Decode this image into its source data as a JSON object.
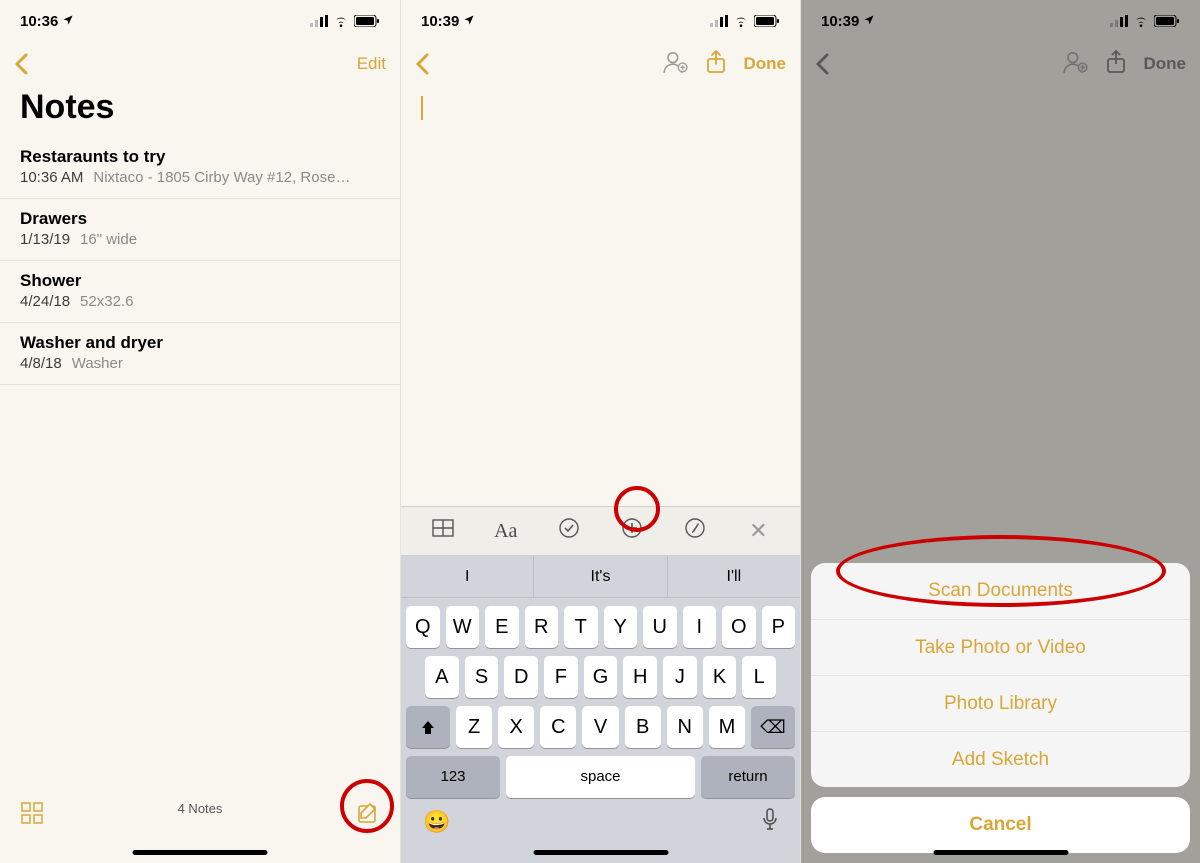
{
  "accent_color": "#d9a638",
  "screen1": {
    "status_time": "10:36",
    "nav_edit": "Edit",
    "title": "Notes",
    "notes": [
      {
        "title": "Restaraunts to try",
        "date": "10:36 AM",
        "preview": "Nixtaco - 1805 Cirby Way #12, Rosevi..."
      },
      {
        "title": "Drawers",
        "date": "1/13/19",
        "preview": "16\" wide"
      },
      {
        "title": "Shower",
        "date": "4/24/18",
        "preview": "52x32.6"
      },
      {
        "title": "Washer and dryer",
        "date": "4/8/18",
        "preview": "Washer"
      }
    ],
    "footer_count": "4 Notes"
  },
  "screen2": {
    "status_time": "10:39",
    "nav_done": "Done",
    "format_bar": [
      "table-icon",
      "Aa",
      "check-circle-icon",
      "plus-circle-icon",
      "stylus-icon",
      "close-icon"
    ],
    "predictions": [
      "I",
      "It's",
      "I'll"
    ],
    "keyboard_rows": [
      [
        "Q",
        "W",
        "E",
        "R",
        "T",
        "Y",
        "U",
        "I",
        "O",
        "P"
      ],
      [
        "A",
        "S",
        "D",
        "F",
        "G",
        "H",
        "J",
        "K",
        "L"
      ],
      [
        "shift",
        "Z",
        "X",
        "C",
        "V",
        "B",
        "N",
        "M",
        "backspace"
      ]
    ],
    "bottom_keys": {
      "num": "123",
      "space": "space",
      "return": "return"
    }
  },
  "screen3": {
    "status_time": "10:39",
    "nav_done": "Done",
    "sheet_items": [
      "Scan Documents",
      "Take Photo or Video",
      "Photo Library",
      "Add Sketch"
    ],
    "cancel": "Cancel"
  }
}
